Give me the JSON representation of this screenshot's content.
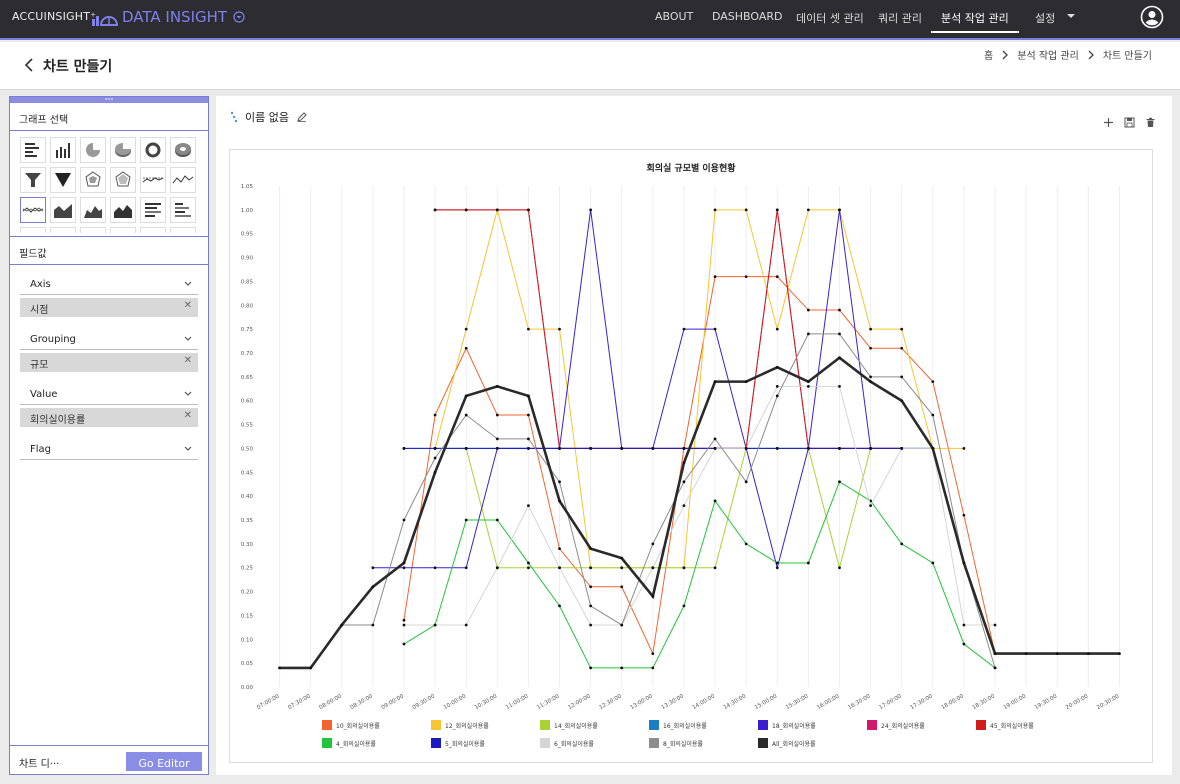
{
  "brand": {
    "company": "ACCUINSIGHT⁺",
    "product": "DATA INSIGHT"
  },
  "nav": {
    "items": [
      {
        "label": "ABOUT",
        "active": false
      },
      {
        "label": "DASHBOARD",
        "active": false
      },
      {
        "label": "데이터 셋 관리",
        "active": false
      },
      {
        "label": "쿼리 관리",
        "active": false
      },
      {
        "label": "분석 작업 관리",
        "active": true
      },
      {
        "label": "설정",
        "active": false
      }
    ]
  },
  "header": {
    "title": "차트 만들기",
    "breadcrumb": [
      "홈",
      "분석 작업 관리",
      "차트 만들기"
    ]
  },
  "left": {
    "graph_select_title": "그래프 선택",
    "field_title": "필드값",
    "fields": [
      {
        "label": "Axis",
        "value": "시점"
      },
      {
        "label": "Grouping",
        "value": "규모"
      },
      {
        "label": "Value",
        "value": "회의실이용률"
      },
      {
        "label": "Flag",
        "value": null
      }
    ],
    "chart_detail_label": "차트 디···",
    "go_editor_label": "Go Editor"
  },
  "main": {
    "chart_name": "이름 없음"
  },
  "colors": {
    "accent": "#7b7fd9",
    "topbar": "#2c2c31",
    "button": "#8a8de6"
  },
  "chart_data": {
    "type": "line",
    "title": "회의실 규모별 이용현황",
    "xlabel": "",
    "ylabel": "",
    "ylim": [
      0,
      1.05
    ],
    "yticks": [
      "0.00",
      "0.05",
      "0.10",
      "0.15",
      "0.20",
      "0.25",
      "0.30",
      "0.35",
      "0.40",
      "0.45",
      "0.50",
      "0.55",
      "0.60",
      "0.65",
      "0.70",
      "0.75",
      "0.80",
      "0.85",
      "0.90",
      "0.95",
      "1.00",
      "1.05"
    ],
    "categories": [
      "07:00:00",
      "07:30:00",
      "08:00:00",
      "08:30:00",
      "09:00:00",
      "09:30:00",
      "10:00:00",
      "10:30:00",
      "11:00:00",
      "11:30:00",
      "12:00:00",
      "12:30:00",
      "13:00:00",
      "13:30:00",
      "14:00:00",
      "14:30:00",
      "15:00:00",
      "15:30:00",
      "16:00:00",
      "16:30:00",
      "17:00:00",
      "17:30:00",
      "18:00:00",
      "18:30:00",
      "19:00:00",
      "19:30:00",
      "20:00:00",
      "20:30:00"
    ],
    "grid": true,
    "legend_position": "bottom",
    "series": [
      {
        "name": "10_회의실이용률",
        "color": "#f4642e",
        "values": [
          null,
          null,
          null,
          null,
          0.14,
          0.57,
          0.71,
          0.57,
          0.57,
          0.29,
          0.21,
          0.21,
          0.07,
          0.5,
          0.86,
          0.86,
          0.86,
          0.79,
          0.79,
          0.71,
          0.71,
          0.64,
          0.36,
          0.07,
          null,
          null,
          null,
          null
        ]
      },
      {
        "name": "12_회의실이용률",
        "color": "#f7c531",
        "values": [
          null,
          null,
          null,
          null,
          null,
          0.5,
          0.75,
          1.0,
          0.75,
          0.75,
          0.25,
          0.25,
          0.25,
          0.25,
          1.0,
          1.0,
          0.75,
          1.0,
          1.0,
          0.75,
          0.75,
          0.5,
          0.5,
          null,
          null,
          null,
          null,
          null
        ]
      },
      {
        "name": "14_회의실이용률",
        "color": "#a8d332",
        "values": [
          null,
          null,
          null,
          null,
          null,
          0.5,
          0.5,
          0.25,
          0.25,
          0.25,
          0.25,
          0.25,
          0.25,
          0.25,
          0.25,
          0.5,
          0.5,
          0.5,
          0.25,
          0.5,
          0.5,
          0.5,
          null,
          null,
          null,
          null,
          null,
          null
        ]
      },
      {
        "name": "16_회의실이용률",
        "color": "#1a7fc4",
        "values": [
          null,
          null,
          null,
          null,
          0.5,
          0.5,
          0.5,
          0.5,
          0.5,
          0.5,
          0.5,
          0.5,
          0.5,
          0.5,
          0.5,
          0.5,
          0.5,
          0.5,
          0.5,
          0.5,
          0.5,
          0.5,
          null,
          null,
          null,
          null,
          null,
          null
        ]
      },
      {
        "name": "18_회의실이용률",
        "color": "#3a1fd1",
        "values": [
          null,
          null,
          null,
          0.25,
          0.25,
          0.25,
          0.25,
          0.5,
          0.5,
          0.5,
          1.0,
          0.5,
          0.5,
          0.75,
          0.75,
          0.5,
          0.25,
          0.5,
          1.0,
          0.5,
          0.5,
          0.5,
          null,
          null,
          null,
          null,
          null,
          null
        ]
      },
      {
        "name": "24_회의실이용률",
        "color": "#d0186e",
        "values": [
          null,
          null,
          null,
          null,
          null,
          1.0,
          1.0,
          1.0,
          1.0,
          0.5,
          0.5,
          0.5,
          0.5,
          0.5,
          0.5,
          0.5,
          1.0,
          0.5,
          0.5,
          0.5,
          0.5,
          null,
          null,
          null,
          null,
          null,
          null,
          null
        ]
      },
      {
        "name": "45_회의실이용률",
        "color": "#d11c1c",
        "values": [
          null,
          null,
          null,
          null,
          null,
          1.0,
          1.0,
          1.0,
          1.0,
          0.5,
          0.5,
          0.5,
          0.5,
          0.5,
          0.5,
          0.5,
          1.0,
          0.5,
          0.5,
          0.5,
          0.5,
          null,
          null,
          null,
          null,
          null,
          null,
          null
        ]
      },
      {
        "name": "4_회의실이용률",
        "color": "#21c43a",
        "values": [
          null,
          null,
          null,
          null,
          0.09,
          0.13,
          0.35,
          0.35,
          0.26,
          0.17,
          0.04,
          0.04,
          0.04,
          0.17,
          0.39,
          0.3,
          0.26,
          0.26,
          0.43,
          0.39,
          0.3,
          0.26,
          0.09,
          0.04,
          null,
          null,
          null,
          null
        ]
      },
      {
        "name": "5_회의실이용률",
        "color": "#1a1ac2",
        "values": [
          null,
          null,
          null,
          null,
          0.5,
          0.5,
          0.5,
          0.5,
          0.5,
          0.5,
          0.5,
          0.5,
          0.5,
          0.5,
          0.5,
          0.5,
          0.5,
          0.5,
          0.5,
          0.5,
          0.5,
          null,
          null,
          null,
          null,
          null,
          null,
          null
        ]
      },
      {
        "name": "6_회의실이용률",
        "color": "#d5d5d5",
        "values": [
          null,
          null,
          null,
          null,
          0.13,
          0.13,
          0.13,
          0.25,
          0.38,
          0.25,
          0.13,
          0.13,
          0.25,
          0.38,
          0.5,
          0.5,
          0.63,
          0.63,
          0.63,
          0.38,
          0.5,
          0.5,
          0.13,
          0.13,
          null,
          null,
          null,
          null
        ]
      },
      {
        "name": "8_회의실이용률",
        "color": "#8c8c8c",
        "values": [
          null,
          null,
          0.13,
          0.13,
          0.35,
          0.48,
          0.57,
          0.52,
          0.52,
          0.43,
          0.17,
          0.13,
          0.3,
          0.43,
          0.52,
          0.43,
          0.61,
          0.74,
          0.74,
          0.65,
          0.65,
          0.57,
          0.26,
          0.04,
          null,
          null,
          null,
          null
        ]
      },
      {
        "name": "All_회의실이용률",
        "color": "#2a2a2a",
        "values": [
          0.04,
          0.04,
          0.13,
          0.21,
          0.26,
          0.45,
          0.61,
          0.63,
          0.61,
          0.39,
          0.29,
          0.27,
          0.19,
          0.47,
          0.64,
          0.64,
          0.67,
          0.64,
          0.69,
          0.64,
          0.6,
          0.5,
          0.26,
          0.07,
          0.07,
          0.07,
          0.07,
          0.07
        ]
      }
    ]
  }
}
